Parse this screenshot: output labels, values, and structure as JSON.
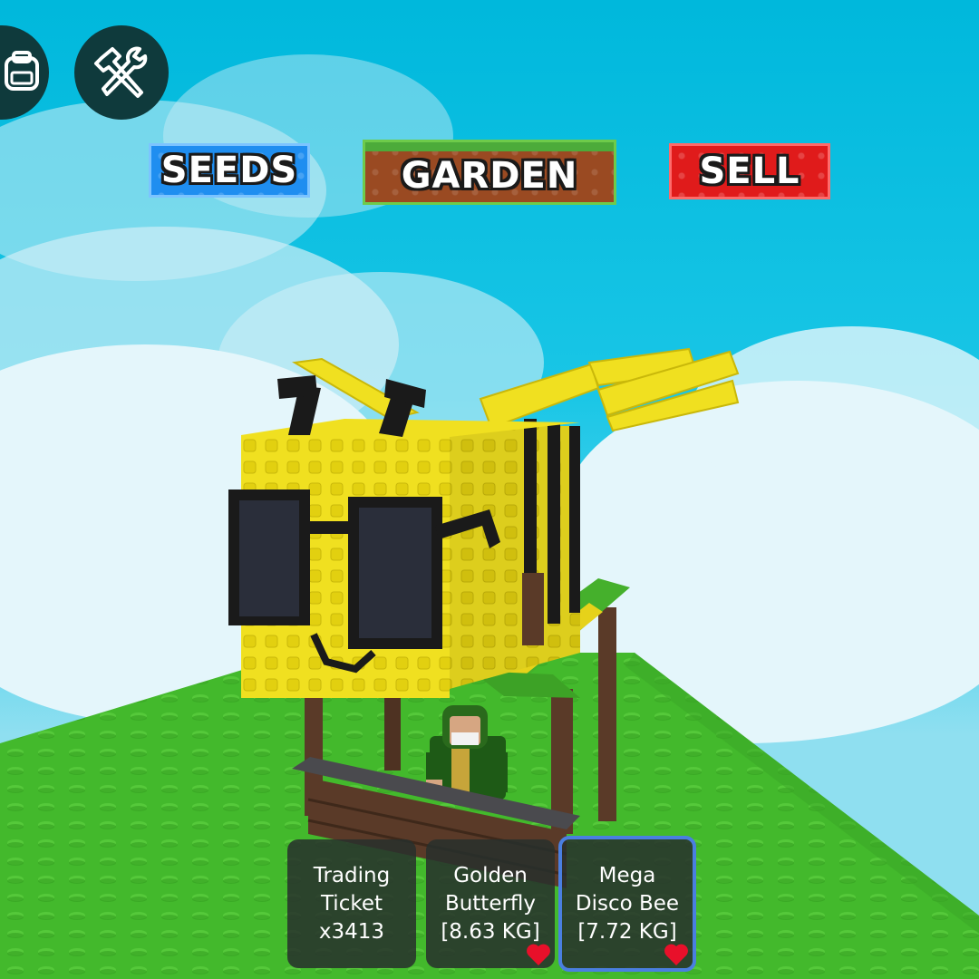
{
  "top_left": {
    "backpack_icon": "backpack-icon",
    "tools_icon": "hammer-wrench-icon"
  },
  "nav": {
    "seeds_label": "SEEDS",
    "garden_label": "GARDEN",
    "sell_label": "SELL",
    "seeds_color": "#1f8ef0",
    "garden_color": "#9a4a22",
    "sell_color": "#e01b1b"
  },
  "hotbar": {
    "items": [
      {
        "line1": "Trading",
        "line2": "Ticket",
        "line3": "x3413",
        "favorited": false,
        "selected": false
      },
      {
        "line1": "Golden",
        "line2": "Butterfly",
        "line3": "[8.63 KG]",
        "favorited": true,
        "selected": false
      },
      {
        "line1": "Mega",
        "line2": "Disco Bee",
        "line3": "[7.72 KG]",
        "favorited": true,
        "selected": true
      }
    ],
    "favorite_icon": "heart-icon",
    "selected_border_color": "#4a7fe0"
  }
}
